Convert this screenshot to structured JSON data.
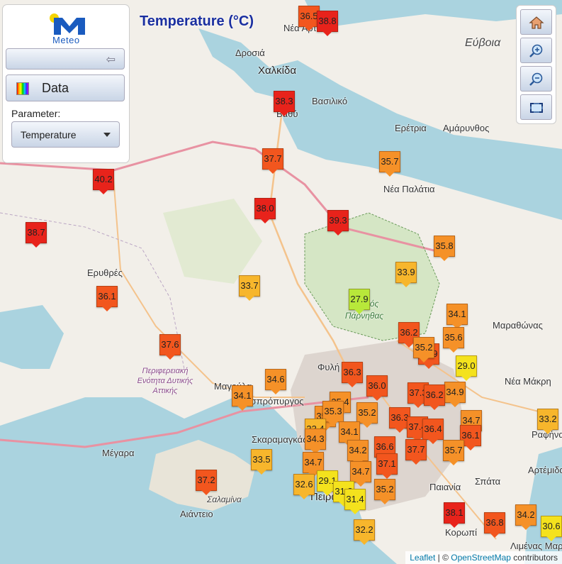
{
  "panel": {
    "logo_text": "Meteo",
    "data_label": "Data",
    "parameter_label": "Parameter:",
    "parameter_value": "Temperature"
  },
  "map_title": "Temperature (°C)",
  "attribution": {
    "leaflet": "Leaflet",
    "separator": " | © ",
    "osm": "OpenStreetMap",
    "contributors": " contributors"
  },
  "places": [
    "Εύβοια",
    "Δροσιά",
    "Χαλκίδα",
    "Βασιλικό",
    "Ερέτρια",
    "Αμάρυνθος",
    "Νέα Παλάτια",
    "Ερυθρές",
    "Μαραθώνας",
    "Νέα Μάκρη",
    "Ραφήνα",
    "Μέγαρα",
    "Σαλαμίνα",
    "Αιάντειο",
    "Σκαραμαγκάς",
    "Ασπρόπυργος",
    "Μαγούλα",
    "Πειραιάς",
    "Παιανία",
    "Σπάτα",
    "Αρτέμιδα",
    "Κορωπί",
    "Λιμένας Μαρκοπούλου",
    "Νέα Αρτάκη",
    "Βαθύ",
    "Φυλή"
  ],
  "park_label": "Δρυμός Πάρνηθας",
  "region_label": "Περιφερειακή Ενότητα Δυτικής Αττικής",
  "colors": {
    "hot": "#e8231b",
    "warm": "#f2561e",
    "mid": "#f59128",
    "mild": "#f7b62c",
    "cool": "#f4e21d",
    "cold": "#b8e83a"
  },
  "stations": [
    {
      "t": "36.5"
    },
    {
      "t": "38.8"
    },
    {
      "t": "38.3"
    },
    {
      "t": "37.7"
    },
    {
      "t": "35.7"
    },
    {
      "t": "40.2"
    },
    {
      "t": "38.0"
    },
    {
      "t": "39.3"
    },
    {
      "t": "38.7"
    },
    {
      "t": "35.8"
    },
    {
      "t": "33.9"
    },
    {
      "t": "33.7"
    },
    {
      "t": "36.1"
    },
    {
      "t": "27.9"
    },
    {
      "t": "34.1"
    },
    {
      "t": "36.2"
    },
    {
      "t": "35.6"
    },
    {
      "t": "37.6"
    },
    {
      "t": "36.9"
    },
    {
      "t": "35.2"
    },
    {
      "t": "36.3"
    },
    {
      "t": "29.0"
    },
    {
      "t": "34.6"
    },
    {
      "t": "36.0"
    },
    {
      "t": "37.3"
    },
    {
      "t": "34.1"
    },
    {
      "t": "35.4"
    },
    {
      "t": "34.9"
    },
    {
      "t": "36.2"
    },
    {
      "t": "35.1"
    },
    {
      "t": "35.3"
    },
    {
      "t": "35.2"
    },
    {
      "t": "36.3"
    },
    {
      "t": "33.4"
    },
    {
      "t": "37.4"
    },
    {
      "t": "36.4"
    },
    {
      "t": "34.7"
    },
    {
      "t": "33.2"
    },
    {
      "t": "34.1"
    },
    {
      "t": "36.1"
    },
    {
      "t": "34.3"
    },
    {
      "t": "34.2"
    },
    {
      "t": "36.6"
    },
    {
      "t": "37.7"
    },
    {
      "t": "35.7"
    },
    {
      "t": "33.5"
    },
    {
      "t": "34.7"
    },
    {
      "t": "34.7"
    },
    {
      "t": "37.1"
    },
    {
      "t": "32.6"
    },
    {
      "t": "29.1"
    },
    {
      "t": "31.8"
    },
    {
      "t": "35.2"
    },
    {
      "t": "37.2"
    },
    {
      "t": "31.4"
    },
    {
      "t": "38.1"
    },
    {
      "t": "36.8"
    },
    {
      "t": "34.2"
    },
    {
      "t": "30.6"
    },
    {
      "t": "32.2"
    }
  ]
}
